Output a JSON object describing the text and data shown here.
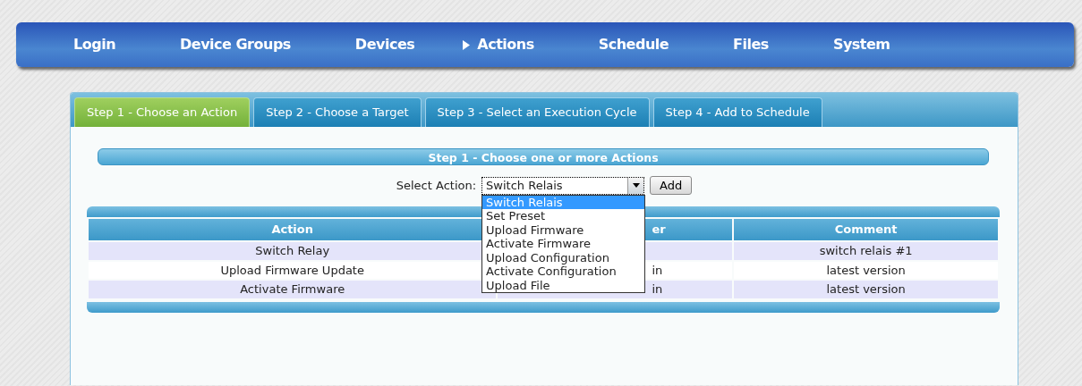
{
  "nav": [
    {
      "label": "Login",
      "selected": false
    },
    {
      "label": "Device Groups",
      "selected": false
    },
    {
      "label": "Devices",
      "selected": false
    },
    {
      "label": "Actions",
      "selected": true
    },
    {
      "label": "Schedule",
      "selected": false
    },
    {
      "label": "Files",
      "selected": false
    },
    {
      "label": "System",
      "selected": false
    }
  ],
  "tabs": [
    {
      "label": "Step 1 - Choose an Action",
      "selected": true
    },
    {
      "label": "Step 2 - Choose a Target",
      "selected": false
    },
    {
      "label": "Step 3 - Select an Execution Cycle",
      "selected": false
    },
    {
      "label": "Step 4 - Add to Schedule",
      "selected": false
    }
  ],
  "step_heading": "Step 1 - Choose one or more Actions",
  "select_action": {
    "label": "Select Action:",
    "value": "Switch Relais",
    "button": "Add",
    "expanded": true,
    "options": [
      {
        "label": "Switch Relais",
        "selected": true
      },
      {
        "label": "Set Preset",
        "selected": false
      },
      {
        "label": "Upload Firmware",
        "selected": false
      },
      {
        "label": "Activate Firmware",
        "selected": false
      },
      {
        "label": "Upload Configuration",
        "selected": false
      },
      {
        "label": "Activate Configuration",
        "selected": false
      },
      {
        "label": "Upload File",
        "selected": false
      }
    ]
  },
  "table": {
    "columns": [
      "Action",
      "er",
      "Comment"
    ],
    "rows": [
      {
        "action": "Switch Relay",
        "comment": "switch relais #1"
      },
      {
        "action": "Upload Firmware Update",
        "column_2": "in",
        "comment": "latest version"
      },
      {
        "action": "Activate Firmware",
        "column_2": "in",
        "comment": "latest version"
      }
    ]
  }
}
